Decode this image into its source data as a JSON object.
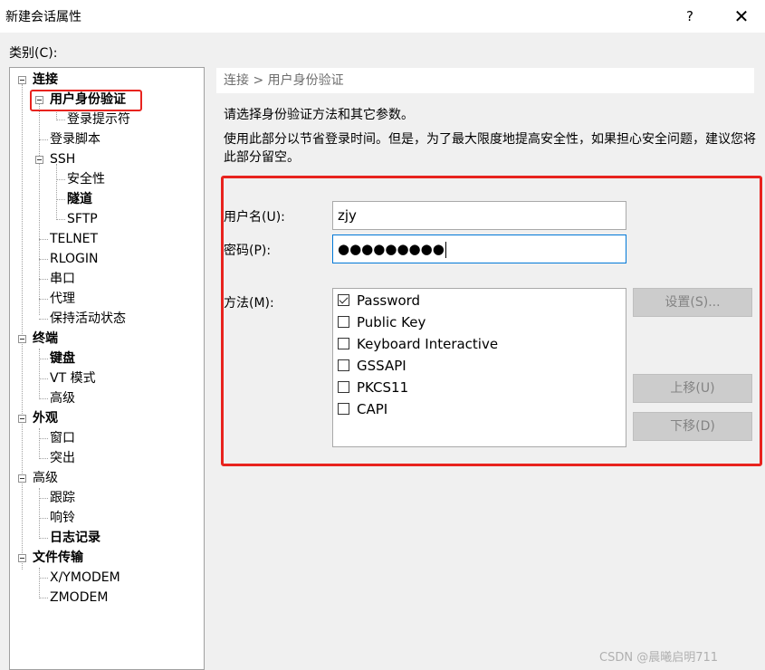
{
  "window": {
    "title": "新建会话属性",
    "help": "?",
    "close": "✕"
  },
  "category_label": "类别(C):",
  "tree": [
    {
      "id": "connect",
      "label": "连接",
      "bold": true,
      "expandable": true
    },
    {
      "id": "auth",
      "label": "用户身份验证",
      "bold": true,
      "expandable": true,
      "selected": true
    },
    {
      "id": "login-prompt",
      "label": "登录提示符"
    },
    {
      "id": "login-script",
      "label": "登录脚本"
    },
    {
      "id": "ssh",
      "label": "SSH",
      "expandable": true
    },
    {
      "id": "security",
      "label": "安全性"
    },
    {
      "id": "tunnel",
      "label": "隧道",
      "bold": true
    },
    {
      "id": "sftp",
      "label": "SFTP"
    },
    {
      "id": "telnet",
      "label": "TELNET"
    },
    {
      "id": "rlogin",
      "label": "RLOGIN"
    },
    {
      "id": "serial",
      "label": "串口"
    },
    {
      "id": "proxy",
      "label": "代理"
    },
    {
      "id": "keepalive",
      "label": "保持活动状态"
    },
    {
      "id": "terminal",
      "label": "终端",
      "bold": true,
      "expandable": true
    },
    {
      "id": "keyboard",
      "label": "键盘",
      "bold": true
    },
    {
      "id": "vt-mode",
      "label": "VT 模式"
    },
    {
      "id": "advanced-term",
      "label": "高级"
    },
    {
      "id": "appearance",
      "label": "外观",
      "bold": true,
      "expandable": true
    },
    {
      "id": "window",
      "label": "窗口"
    },
    {
      "id": "highlight",
      "label": "突出"
    },
    {
      "id": "advanced",
      "label": "高级",
      "expandable": true
    },
    {
      "id": "trace",
      "label": "跟踪"
    },
    {
      "id": "bell",
      "label": "响铃"
    },
    {
      "id": "log",
      "label": "日志记录",
      "bold": true
    },
    {
      "id": "file-transfer",
      "label": "文件传输",
      "bold": true,
      "expandable": true
    },
    {
      "id": "xymodem",
      "label": "X/YMODEM"
    },
    {
      "id": "zmodem",
      "label": "ZMODEM"
    }
  ],
  "breadcrumb": "连接 > 用户身份验证",
  "desc1": "请选择身份验证方法和其它参数。",
  "desc2": "使用此部分以节省登录时间。但是，为了最大限度地提高安全性，如果担心安全问题，建议您将此部分留空。",
  "auth": {
    "username_label": "用户名(U):",
    "username_value": "zjy",
    "password_label": "密码(P):",
    "password_value": "●●●●●●●●●",
    "method_label": "方法(M):",
    "methods": [
      {
        "label": "Password",
        "checked": true
      },
      {
        "label": "Public Key",
        "checked": false
      },
      {
        "label": "Keyboard Interactive",
        "checked": false
      },
      {
        "label": "GSSAPI",
        "checked": false
      },
      {
        "label": "PKCS11",
        "checked": false
      },
      {
        "label": "CAPI",
        "checked": false
      }
    ],
    "settings_button": "设置(S)...",
    "move_up_button": "上移(U)",
    "move_down_button": "下移(D)"
  },
  "watermark": "CSDN @晨曦启明711",
  "colors": {
    "highlight_red": "#e8231e",
    "focus_blue": "#0078d7"
  }
}
